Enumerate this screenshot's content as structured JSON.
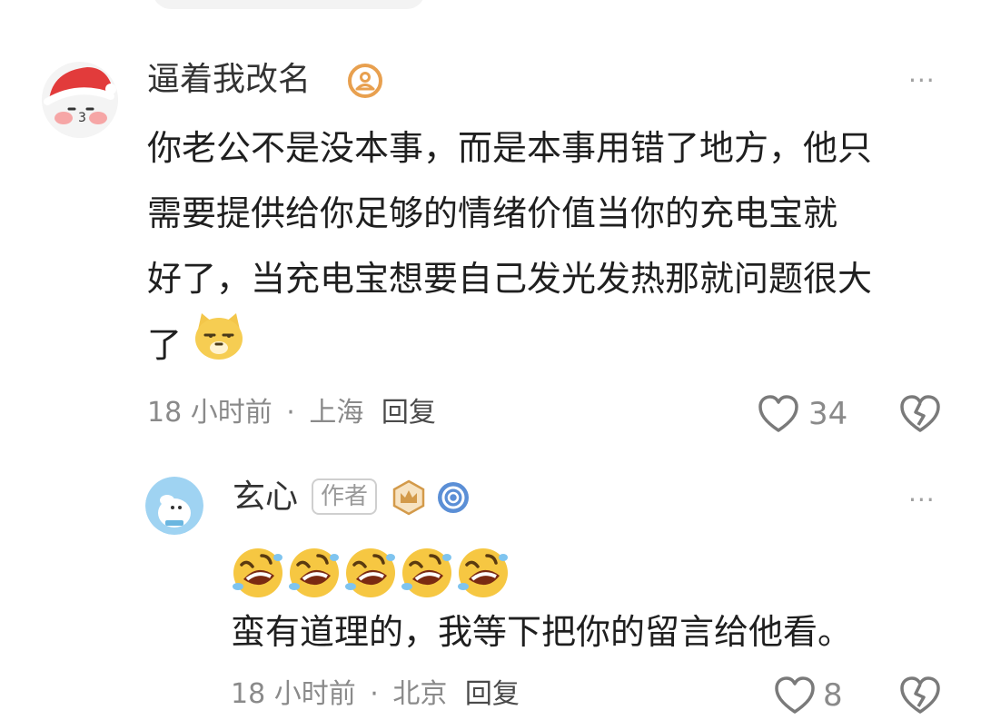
{
  "comment": {
    "username": "逼着我改名",
    "text_lines": [
      "你老公不是没本事，而是本事用错了地方，他只",
      "需要提供给你足够的情绪价值当你的充电宝就",
      "好了，当充电宝想要自己发光发热那就问题很大",
      "了"
    ],
    "time": "18 小时前",
    "separator": "·",
    "location": "上海",
    "reply_label": "回复",
    "like_count": "34",
    "more_label": "···"
  },
  "reply": {
    "username": "玄心",
    "author_tag": "作者",
    "emoji_line_count": 5,
    "text": "蛮有道理的，我等下把你的留言给他看。",
    "time": "18 小时前",
    "separator": "·",
    "location": "北京",
    "reply_label": "回复",
    "like_count": "8",
    "more_label": "···"
  },
  "colors": {
    "text": "#1f1f1f",
    "meta": "#8a8a8a",
    "icon": "#7a7a7a",
    "badge_orange": "#e8a04f",
    "badge_blue": "#5b8fd6"
  },
  "icons": [
    "user-badge-icon",
    "heart-icon",
    "broken-heart-icon",
    "more-icon",
    "crown-badge-icon",
    "ring-badge-icon",
    "cat-emoji",
    "rofl-emoji"
  ]
}
